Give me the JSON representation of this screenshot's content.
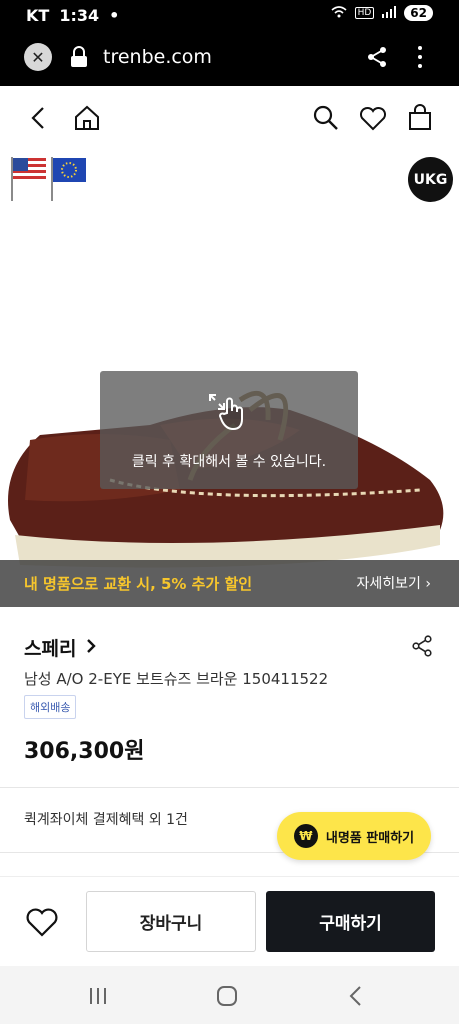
{
  "status_bar": {
    "carrier": "KT",
    "time": "1:34",
    "dot": "•",
    "hd_label": "HD",
    "battery": "62"
  },
  "browser": {
    "url": "trenbe.com"
  },
  "product": {
    "zoom_hint": "클릭 후 확대해서 볼 수 있습니다.",
    "promo_text": "내 명품으로 교환 시, 5% 추가 할인",
    "promo_link": "자세히보기",
    "brand": "스페리",
    "name": "남성 A/O 2-EYE 보트슈즈 브라운 150411522",
    "badge": "해외배송",
    "price": "306,300원",
    "seller_logo": "UKG"
  },
  "benefits": {
    "text": "퀵계좌이체 결제혜택 외 1건"
  },
  "fab": {
    "label": "내명품 판매하기",
    "icon": "₩"
  },
  "actions": {
    "cart_label": "장바구니",
    "buy_label": "구매하기"
  },
  "icons": [
    "close-icon",
    "lock-icon",
    "share-icon",
    "more-icon",
    "back-icon",
    "home-icon",
    "search-icon",
    "heart-icon",
    "bag-icon",
    "us-flag-icon",
    "eu-flag-icon",
    "expand-icon",
    "hand-pointer-icon",
    "chevron-right-icon",
    "recents-icon",
    "home-nav-icon",
    "back-nav-icon"
  ],
  "colors": {
    "accent_yellow": "#fde54a",
    "promo_text": "#f7c62c",
    "buy_button": "#15181d"
  }
}
